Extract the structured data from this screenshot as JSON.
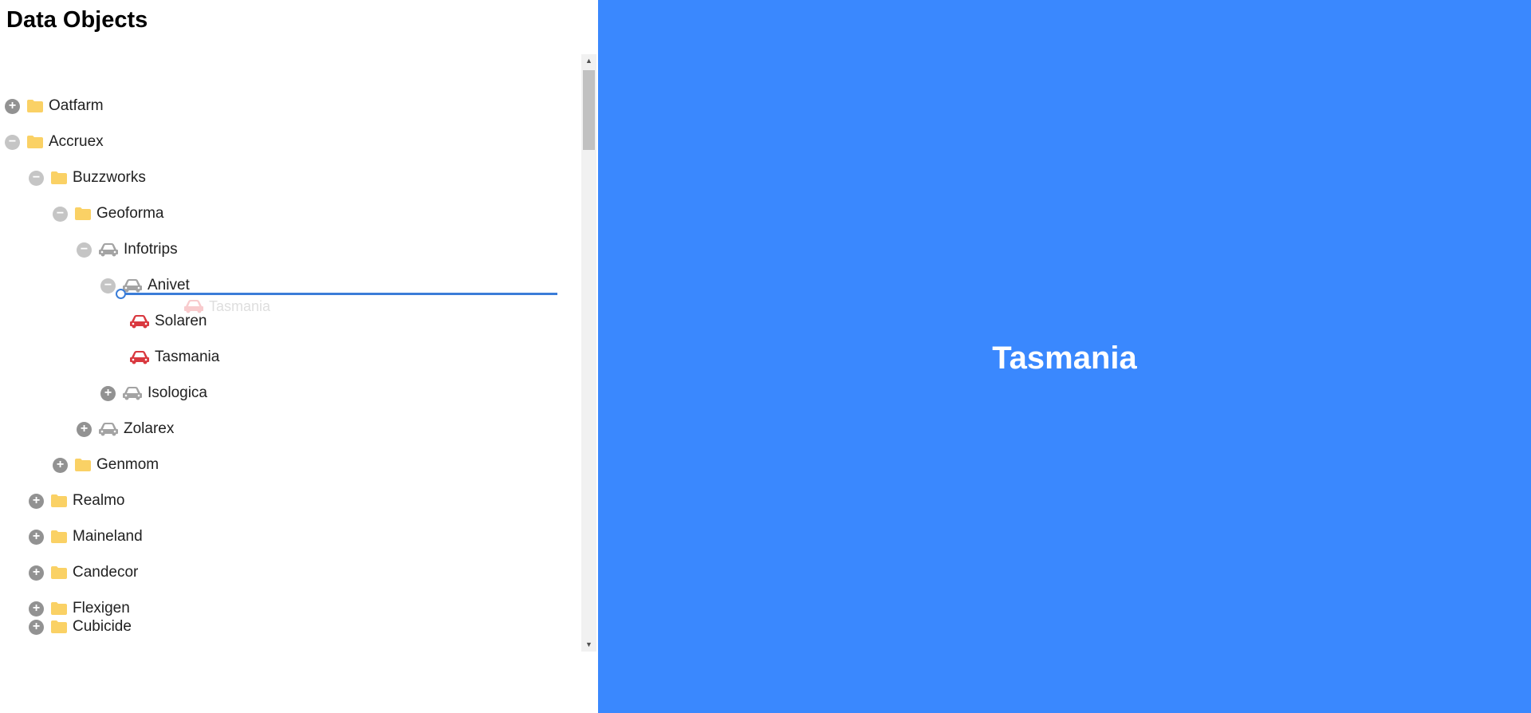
{
  "page_title": "Data Objects",
  "tree": {
    "items": [
      {
        "label": "Oatfarm",
        "toggle": "+",
        "icon": "folder-icon"
      },
      {
        "label": "Accruex",
        "toggle": "−",
        "icon": "folder-icon"
      },
      {
        "label": "Buzzworks",
        "toggle": "−",
        "icon": "folder-icon"
      },
      {
        "label": "Geoforma",
        "toggle": "−",
        "icon": "folder-icon"
      },
      {
        "label": "Infotrips",
        "toggle": "−",
        "icon": "car-icon"
      },
      {
        "label": "Anivet",
        "toggle": "−",
        "icon": "car-icon"
      },
      {
        "label": "Solaren",
        "toggle": "",
        "icon": "car-icon"
      },
      {
        "label": "Tasmania",
        "toggle": "",
        "icon": "car-icon"
      },
      {
        "label": "Isologica",
        "toggle": "+",
        "icon": "car-icon"
      },
      {
        "label": "Zolarex",
        "toggle": "+",
        "icon": "car-icon"
      },
      {
        "label": "Genmom",
        "toggle": "+",
        "icon": "folder-icon"
      },
      {
        "label": "Realmo",
        "toggle": "+",
        "icon": "folder-icon"
      },
      {
        "label": "Maineland",
        "toggle": "+",
        "icon": "folder-icon"
      },
      {
        "label": "Candecor",
        "toggle": "+",
        "icon": "folder-icon"
      },
      {
        "label": "Flexigen",
        "toggle": "+",
        "icon": "folder-icon"
      },
      {
        "label": "Cubicide",
        "toggle": "+",
        "icon": "folder-icon"
      }
    ]
  },
  "drag_ghost": {
    "label": "Tasmania",
    "icon": "car-icon"
  },
  "detail": {
    "title": "Tasmania"
  },
  "colors": {
    "folder": "#fad165",
    "car_group": "#a3a3a3",
    "car_leaf": "#d9383f",
    "drop_indicator": "#3b7dd8",
    "detail_background": "#3a88fe"
  }
}
